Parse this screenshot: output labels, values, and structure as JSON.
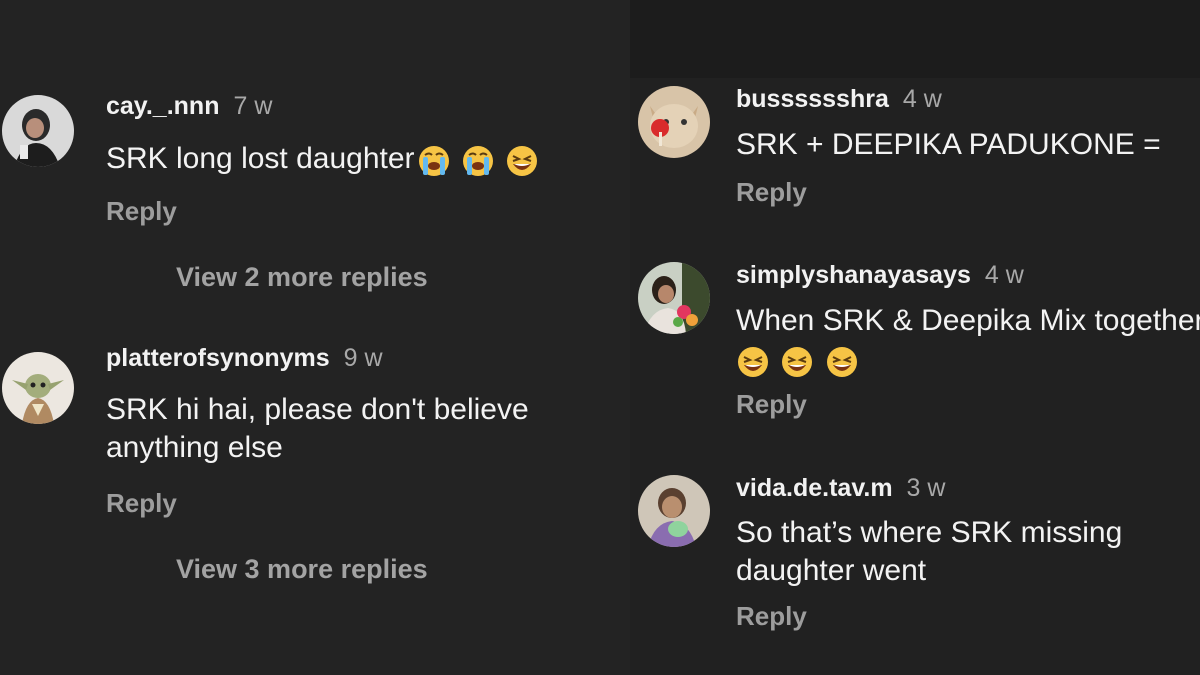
{
  "left": {
    "comments": [
      {
        "username": "cay._.nnn",
        "time": "7 w",
        "text": "SRK long lost daughter",
        "emojis": [
          "loudly-crying-emoji",
          "loudly-crying-emoji",
          "grinning-squint-emoji"
        ],
        "reply": "Reply",
        "more_replies": "View 2 more replies"
      },
      {
        "username": "platterofsynonyms",
        "time": "9 w",
        "text_lines": [
          "SRK hi hai, please don't believe",
          "anything else"
        ],
        "reply": "Reply",
        "more_replies": "View 3 more replies"
      }
    ]
  },
  "right": {
    "comments": [
      {
        "username": "busssssshra",
        "time": "4 w",
        "text": "SRK + DEEPIKA PADUKONE =",
        "reply": "Reply"
      },
      {
        "username": "simplyshanayasays",
        "time": "4 w",
        "text": "When SRK & Deepika Mix together",
        "emojis": [
          "grinning-squint-emoji",
          "grinning-squint-emoji",
          "grinning-squint-emoji"
        ],
        "reply": "Reply"
      },
      {
        "username": "vida.de.tav.m",
        "time": "3 w",
        "text_lines": [
          "So that’s where SRK missing",
          "daughter went"
        ],
        "reply": "Reply"
      }
    ]
  },
  "colors": {
    "background": "#232323",
    "text": "#f3f3f3",
    "muted": "#9d9d9d"
  }
}
